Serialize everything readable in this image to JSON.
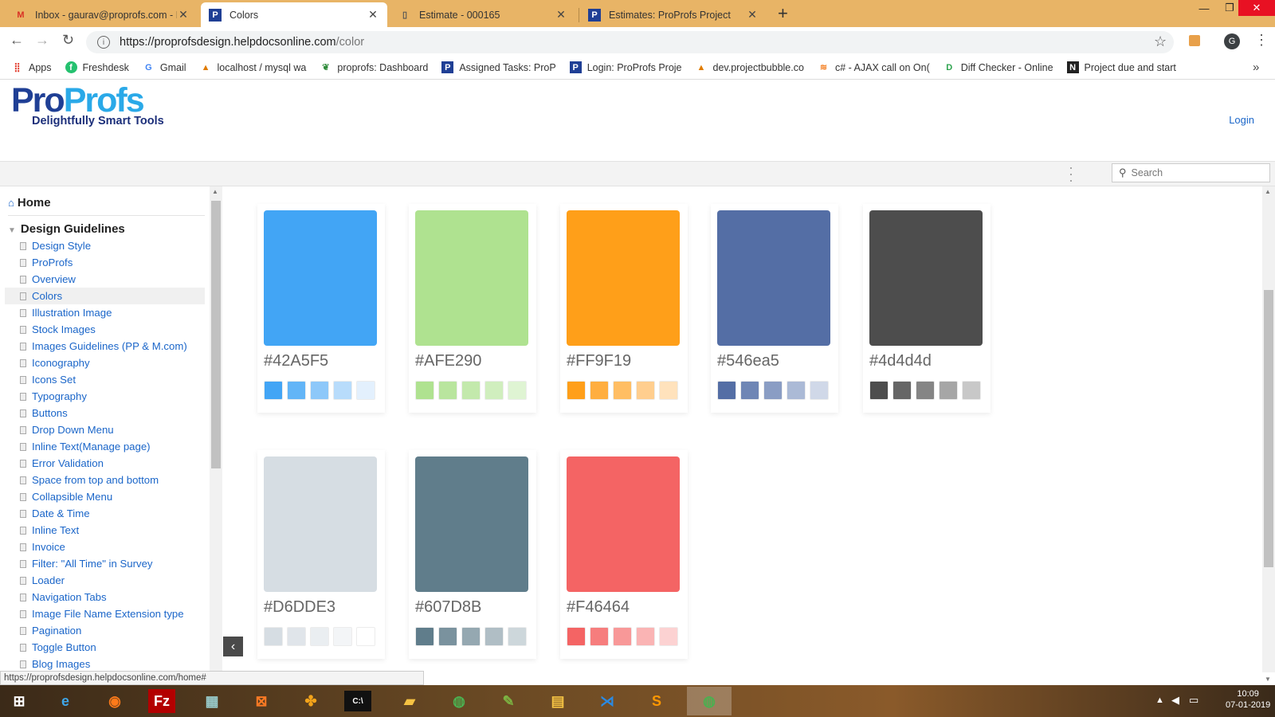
{
  "browser": {
    "tabs": [
      {
        "title": "Inbox - gaurav@proprofs.com - I",
        "icon": "gmail-icon",
        "active": false
      },
      {
        "title": "Colors",
        "icon": "proprofs-icon",
        "active": true
      },
      {
        "title": "Estimate - 000165",
        "icon": "document-icon",
        "active": false
      },
      {
        "title": "Estimates: ProProfs Project",
        "icon": "proprofs-icon",
        "active": false
      }
    ],
    "url_host": "https://proprofsdesign.helpdocsonline.com",
    "url_path": "/color",
    "bookmarks": [
      {
        "label": "Apps",
        "icon": "apps-grid-icon"
      },
      {
        "label": "Freshdesk",
        "icon": "freshdesk-icon"
      },
      {
        "label": "Gmail",
        "icon": "google-icon"
      },
      {
        "label": "localhost / mysql wa",
        "icon": "phpmyadmin-icon"
      },
      {
        "label": "proprofs: Dashboard",
        "icon": "leaf-icon"
      },
      {
        "label": "Assigned Tasks: ProP",
        "icon": "proprofs-icon"
      },
      {
        "label": "Login: ProProfs Proje",
        "icon": "proprofs-icon"
      },
      {
        "label": "dev.projectbubble.co",
        "icon": "phpmyadmin-icon"
      },
      {
        "label": "c# - AJAX call on On(",
        "icon": "stackoverflow-icon"
      },
      {
        "label": "Diff Checker - Online",
        "icon": "diffchecker-icon"
      },
      {
        "label": "Project due and start",
        "icon": "notion-icon"
      }
    ],
    "avatar_letter": "G"
  },
  "header": {
    "logo_part1": "Pro",
    "logo_part2": "Profs",
    "tagline": "Delightfully Smart Tools",
    "login_label": "Login",
    "search_placeholder": "Search"
  },
  "sidebar": {
    "home_label": "Home",
    "section_label": "Design Guidelines",
    "items": [
      {
        "label": "Design Style",
        "selected": false
      },
      {
        "label": "ProProfs",
        "selected": false
      },
      {
        "label": "Overview",
        "selected": false
      },
      {
        "label": "Colors",
        "selected": true
      },
      {
        "label": "Illustration Image",
        "selected": false
      },
      {
        "label": "Stock Images",
        "selected": false
      },
      {
        "label": "Images Guidelines (PP & M.com)",
        "selected": false
      },
      {
        "label": "Iconography",
        "selected": false
      },
      {
        "label": "Icons Set",
        "selected": false
      },
      {
        "label": "Typography",
        "selected": false
      },
      {
        "label": "Buttons",
        "selected": false
      },
      {
        "label": "Drop Down Menu",
        "selected": false
      },
      {
        "label": "Inline Text(Manage page)",
        "selected": false
      },
      {
        "label": "Error Validation",
        "selected": false
      },
      {
        "label": "Space from top and bottom",
        "selected": false
      },
      {
        "label": "Collapsible Menu",
        "selected": false
      },
      {
        "label": "Date & Time",
        "selected": false
      },
      {
        "label": "Inline Text",
        "selected": false
      },
      {
        "label": "Invoice",
        "selected": false
      },
      {
        "label": "Filter: \"All Time\" in Survey",
        "selected": false
      },
      {
        "label": "Loader",
        "selected": false
      },
      {
        "label": "Navigation Tabs",
        "selected": false
      },
      {
        "label": "Image File Name Extension type",
        "selected": false
      },
      {
        "label": "Pagination",
        "selected": false
      },
      {
        "label": "Toggle Button",
        "selected": false
      },
      {
        "label": "Blog Images",
        "selected": false
      }
    ]
  },
  "colors": [
    {
      "hex": "#42A5F5",
      "color": "#42A5F5",
      "tints": [
        "#42A5F5",
        "#62B5F7",
        "#8DC8F9",
        "#B8DCFB",
        "#E3F0FD"
      ]
    },
    {
      "hex": "#AFE290",
      "color": "#AFE290",
      "tints": [
        "#AFE290",
        "#B9E59E",
        "#C3E9AC",
        "#D0EEBE",
        "#DFF4D3"
      ]
    },
    {
      "hex": "#FF9F19",
      "color": "#FF9F19",
      "tints": [
        "#FF9F19",
        "#FFAE3F",
        "#FFBE63",
        "#FFCE8E",
        "#FFE2BC"
      ]
    },
    {
      "hex": "#546ea5",
      "color": "#546ea5",
      "tints": [
        "#546ea5",
        "#6F86B5",
        "#8A9DC4",
        "#ABBAD6",
        "#D0D8E8"
      ]
    },
    {
      "hex": "#4d4d4d",
      "color": "#4d4d4d",
      "tints": [
        "#4d4d4d",
        "#666666",
        "#858585",
        "#A6A6A6",
        "#C8C8C8"
      ]
    },
    {
      "hex": "#D6DDE3",
      "color": "#D6DDE3",
      "tints": [
        "#D6DDE3",
        "#E0E5EA",
        "#EAEEF1",
        "#F3F5F7",
        "#FFFFFF"
      ]
    },
    {
      "hex": "#607D8B",
      "color": "#607D8B",
      "tints": [
        "#607D8B",
        "#7A929E",
        "#95A8B1",
        "#B0BEC5",
        "#CDD7DB"
      ]
    },
    {
      "hex": "#F46464",
      "color": "#F46464",
      "tints": [
        "#F46464",
        "#F67D7D",
        "#F89898",
        "#FAB4B4",
        "#FCD2D2"
      ]
    }
  ],
  "status_url": "https://proprofsdesign.helpdocsonline.com/home#",
  "taskbar": {
    "time": "10:09",
    "date": "07-01-2019"
  }
}
